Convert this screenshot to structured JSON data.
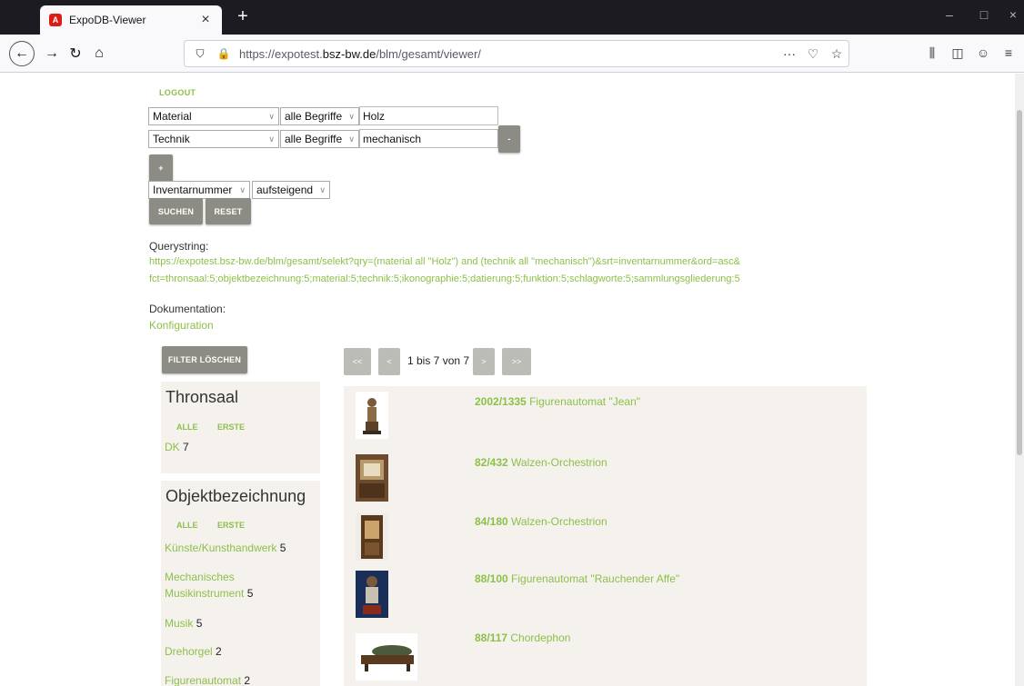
{
  "browser": {
    "tab_title": "ExpoDB-Viewer",
    "tab_favicon": "A",
    "url_prefix": "https://expotest.",
    "url_domain": "bsz-bw.de",
    "url_path": "/blm/gesamt/viewer/"
  },
  "page": {
    "logout": "LOGOUT",
    "rows": [
      {
        "field": "Material",
        "mode": "alle Begriffe",
        "value": "Holz"
      },
      {
        "field": "Technik",
        "mode": "alle Begriffe",
        "value": "mechanisch"
      }
    ],
    "remove_label": "-",
    "add_label": "+",
    "sort_field": "Inventarnummer",
    "sort_order": "aufsteigend",
    "search_label": "SUCHEN",
    "reset_label": "RESET",
    "querystring_label": "Querystring:",
    "querystring_line1": "https://expotest.bsz-bw.de/blm/gesamt/selekt?qry=(material all \"Holz\") and (technik all \"mechanisch\")&srt=inventarnummer&ord=asc&",
    "querystring_line2": "fct=thronsaal:5;objektbezeichnung:5;material:5;technik:5;ikonographie:5;datierung:5;funktion:5;schlagworte:5;sammlungsgliederung:5",
    "doc_label": "Dokumentation:",
    "doc_link": "Konfiguration",
    "filter_clear": "FILTER LÖSCHEN",
    "pager": {
      "first": "<<",
      "prev": "<",
      "label": "1 bis 7 von 7",
      "next": ">",
      "last": ">>"
    },
    "facets": [
      {
        "title": "Thronsaal",
        "all": "ALLE",
        "first": "ERSTE",
        "items": [
          {
            "label": "DK",
            "count": "7"
          }
        ]
      },
      {
        "title": "Objektbezeichnung",
        "all": "ALLE",
        "first": "ERSTE",
        "items": [
          {
            "label": "Künste/Kunsthandwerk",
            "count": "5"
          },
          {
            "label": "Mechanisches Musikinstrument",
            "count": "5"
          },
          {
            "label": "Musik",
            "count": "5"
          },
          {
            "label": "Drehorgel",
            "count": "2"
          },
          {
            "label": "Figurenautomat",
            "count": "2"
          }
        ]
      }
    ],
    "results": [
      {
        "inv": "2002/1335",
        "title": "Figurenautomat \"Jean\""
      },
      {
        "inv": "82/432",
        "title": "Walzen-Orchestrion"
      },
      {
        "inv": "84/180",
        "title": "Walzen-Orchestrion"
      },
      {
        "inv": "88/100",
        "title": "Figurenautomat \"Rauchender Affe\""
      },
      {
        "inv": "88/117",
        "title": "Chordephon"
      }
    ]
  },
  "colors": {
    "accent": "#8dc049",
    "button": "#8c8c84",
    "panel": "#f5f2ee"
  }
}
